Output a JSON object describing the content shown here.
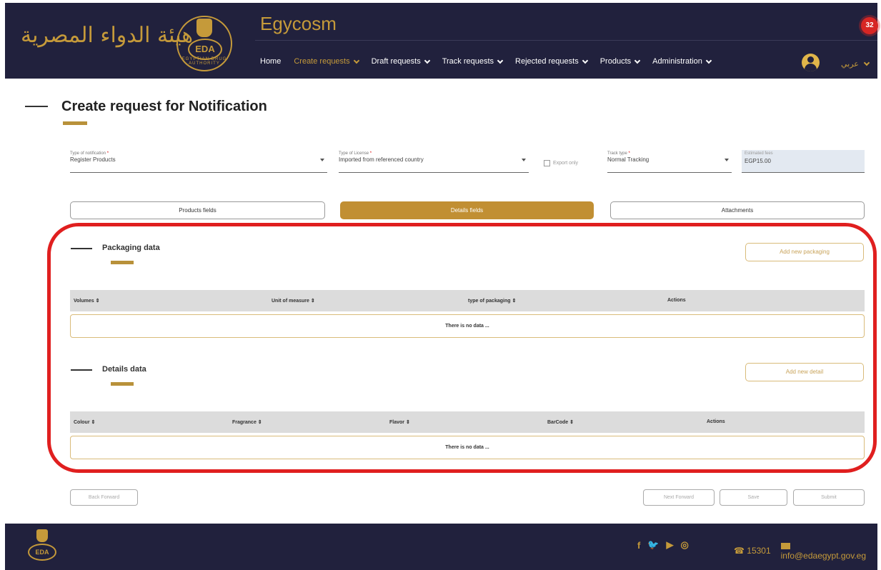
{
  "header": {
    "arabic_logo_text": "هيئة الدواء المصرية",
    "seal_text": "EDA",
    "seal_ring_text": "EGYPTIAN DRUG AUTHORITY",
    "app_title": "Egycosm",
    "notification_count": "32",
    "nav": [
      {
        "label": "Home",
        "dropdown": false,
        "active": false
      },
      {
        "label": "Create requests",
        "dropdown": true,
        "active": true
      },
      {
        "label": "Draft requests",
        "dropdown": true,
        "active": false
      },
      {
        "label": "Track requests",
        "dropdown": true,
        "active": false
      },
      {
        "label": "Rejected requests",
        "dropdown": true,
        "active": false
      },
      {
        "label": "Products",
        "dropdown": true,
        "active": false
      },
      {
        "label": "Administration",
        "dropdown": true,
        "active": false
      }
    ],
    "language_label": "عربي"
  },
  "page": {
    "title": "Create request for Notification"
  },
  "form": {
    "type_of_notification": {
      "label": "Type of notification",
      "value": "Register Products"
    },
    "type_of_license": {
      "label": "Type of License",
      "value": "Imported from referenced country"
    },
    "export_only": {
      "label": "Export only"
    },
    "track_type": {
      "label": "Track type",
      "value": "Normal Tracking"
    },
    "fees": {
      "label": "Estimated fees",
      "value": "EGP15.00"
    }
  },
  "tabs": [
    {
      "label": "Products fields",
      "active": false
    },
    {
      "label": "Details fields",
      "active": true
    },
    {
      "label": "Attachments",
      "active": false
    }
  ],
  "packaging": {
    "title": "Packaging data",
    "add_button": "Add new packaging",
    "columns": [
      "Volumes ⇕",
      "Unit of measure ⇕",
      "type of packaging ⇕",
      "Actions"
    ],
    "empty_text": "There is no data ..."
  },
  "details": {
    "title": "Details data",
    "add_button": "Add new detail",
    "columns": [
      "Colour ⇕",
      "Fragrance ⇕",
      "Flavor ⇕",
      "BarCode ⇕",
      "Actions"
    ],
    "empty_text": "There is no data ..."
  },
  "actions": {
    "back": "Back Forward",
    "next": "Next Forward",
    "save": "Save",
    "submit": "Submit"
  },
  "footer": {
    "seal_text": "EDA",
    "social": [
      "f",
      "🐦",
      "▶",
      "◎"
    ],
    "phone": "15301",
    "email": "info@edaegypt.gov.eg"
  },
  "colors": {
    "navy": "#21213d",
    "gold": "#c59a3a",
    "highlight_red": "#e01f1f"
  }
}
